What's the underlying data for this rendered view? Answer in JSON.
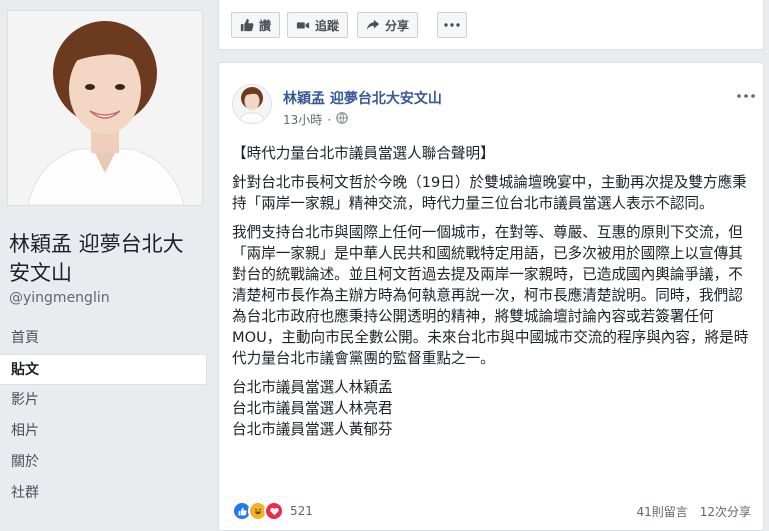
{
  "page": {
    "name": "林穎孟 迎夢台北大安文山",
    "handle": "@yingmenglin"
  },
  "nav": {
    "items": [
      {
        "label": "首頁",
        "active": false
      },
      {
        "label": "貼文",
        "active": true
      },
      {
        "label": "影片",
        "active": false
      },
      {
        "label": "相片",
        "active": false
      },
      {
        "label": "關於",
        "active": false
      },
      {
        "label": "社群",
        "active": false
      }
    ]
  },
  "actionbar": {
    "like_label": "讚",
    "follow_label": "追蹤",
    "share_label": "分享"
  },
  "post": {
    "author": "林穎孟 迎夢台北大安文山",
    "time": "13小時",
    "title": "【時代力量台北市議員當選人聯合聲明】",
    "paragraph1": "針對台北市長柯文哲於今晚（19日）於雙城論壇晚宴中，主動再次提及雙方應秉持「兩岸一家親」精神交流，時代力量三位台北市議員當選人表示不認同。",
    "paragraph2": "我們支持台北市與國際上任何一個城市，在對等、尊嚴、互惠的原則下交流，但「兩岸一家親」是中華人民共和國統戰特定用語，已多次被用於國際上以宣傳其對台的統戰論述。並且柯文哲過去提及兩岸一家親時，已造成國內輿論爭議，不清楚柯市長作為主辦方時為何執意再說一次，柯市長應清楚說明。同時，我們認為台北市政府也應秉持公開透明的精神，將雙城論壇討論內容或若簽署任何MOU，主動向市民全數公開。未來台北市與中國城市交流的程序與內容，將是時代力量台北市議會黨團的監督重點之一。",
    "signatures": [
      "台北市議員當選人林穎孟",
      "台北市議員當選人林亮君",
      "台北市議員當選人黃郁芬"
    ],
    "reaction_count": "521",
    "comments": "41則留言",
    "shares": "12次分享"
  },
  "colors": {
    "link": "#365899",
    "like_blue": "#2078f4",
    "haha_yellow": "#f7b125",
    "love_red": "#f0284a"
  },
  "icons": [
    "like-icon",
    "follow-icon",
    "share-icon",
    "globe-icon",
    "more-icon",
    "like-reaction-icon",
    "haha-reaction-icon",
    "love-reaction-icon"
  ]
}
